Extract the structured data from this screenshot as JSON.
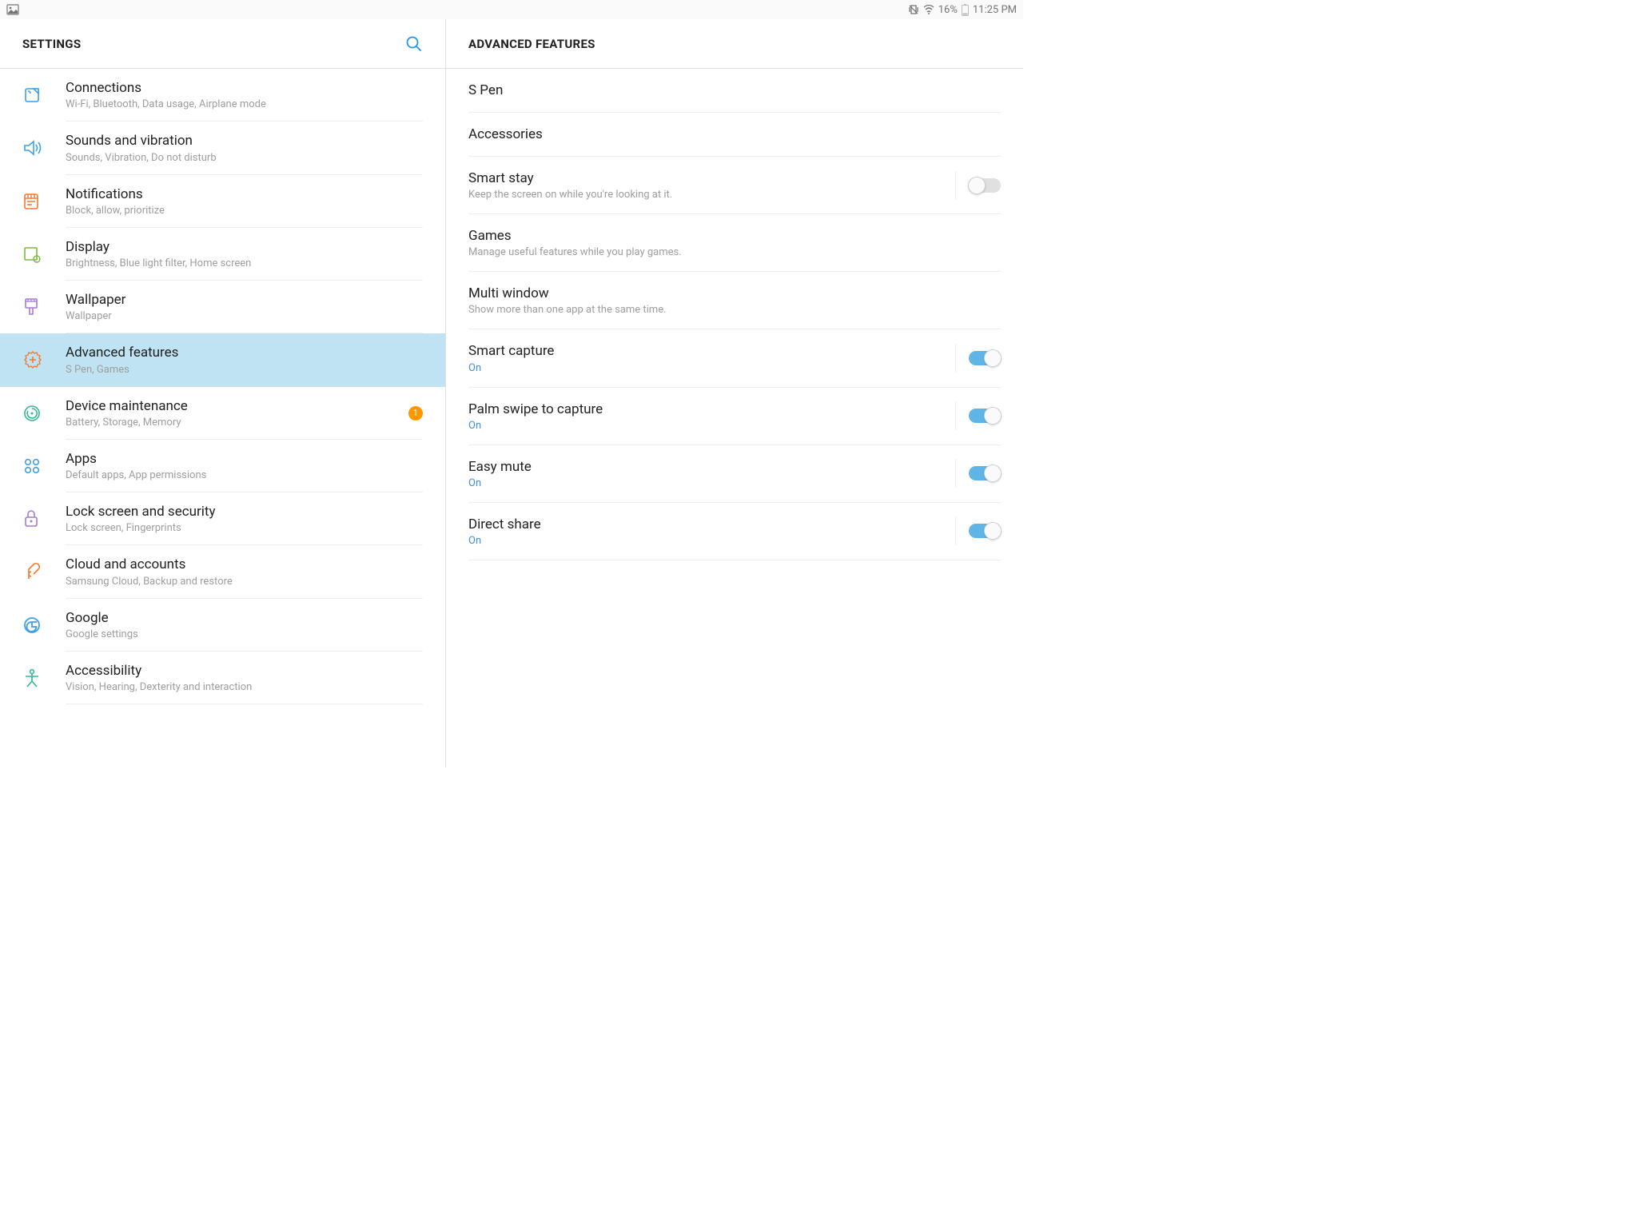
{
  "status": {
    "battery": "16%",
    "time": "11:25 PM"
  },
  "left": {
    "title": "SETTINGS",
    "items": [
      {
        "title": "Connections",
        "sub": "Wi-Fi, Bluetooth, Data usage, Airplane mode"
      },
      {
        "title": "Sounds and vibration",
        "sub": "Sounds, Vibration, Do not disturb"
      },
      {
        "title": "Notifications",
        "sub": "Block, allow, prioritize"
      },
      {
        "title": "Display",
        "sub": "Brightness, Blue light filter, Home screen"
      },
      {
        "title": "Wallpaper",
        "sub": "Wallpaper"
      },
      {
        "title": "Advanced features",
        "sub": "S Pen, Games"
      },
      {
        "title": "Device maintenance",
        "sub": "Battery, Storage, Memory",
        "badge": "1"
      },
      {
        "title": "Apps",
        "sub": "Default apps, App permissions"
      },
      {
        "title": "Lock screen and security",
        "sub": "Lock screen, Fingerprints"
      },
      {
        "title": "Cloud and accounts",
        "sub": "Samsung Cloud, Backup and restore"
      },
      {
        "title": "Google",
        "sub": "Google settings"
      },
      {
        "title": "Accessibility",
        "sub": "Vision, Hearing, Dexterity and interaction"
      }
    ]
  },
  "right": {
    "title": "ADVANCED FEATURES",
    "items": [
      {
        "title": "S Pen"
      },
      {
        "title": "Accessories"
      },
      {
        "title": "Smart stay",
        "sub": "Keep the screen on while you're looking at it.",
        "toggle": "off"
      },
      {
        "title": "Games",
        "sub": "Manage useful features while you play games."
      },
      {
        "title": "Multi window",
        "sub": "Show more than one app at the same time."
      },
      {
        "title": "Smart capture",
        "sub": "On",
        "subOn": true,
        "toggle": "on"
      },
      {
        "title": "Palm swipe to capture",
        "sub": "On",
        "subOn": true,
        "toggle": "on"
      },
      {
        "title": "Easy mute",
        "sub": "On",
        "subOn": true,
        "toggle": "on"
      },
      {
        "title": "Direct share",
        "sub": "On",
        "subOn": true,
        "toggle": "on"
      }
    ]
  },
  "colors": {
    "accent": "#2196f3",
    "selection": "#bfe3f2",
    "badge": "#ff9800"
  }
}
